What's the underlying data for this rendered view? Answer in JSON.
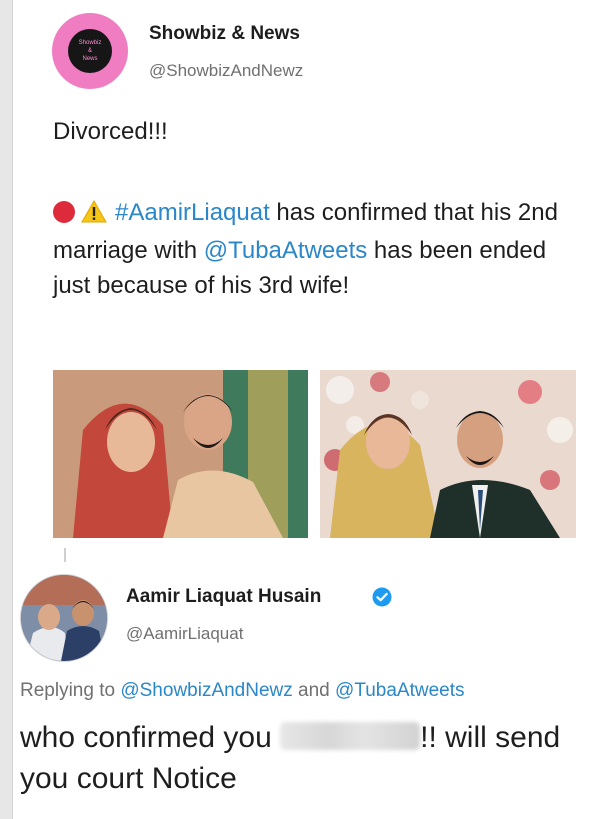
{
  "tweet": {
    "author_name": "Showbiz & News",
    "author_handle": "@ShowbizAndNewz",
    "avatar_text": [
      "Showbiz",
      "&",
      "News"
    ],
    "line1": "Divorced!!!",
    "hashtag": "#AamirLiaquat",
    "text_after_hashtag": " has confirmed that his 2nd marriage with ",
    "mention": "@TubaAtweets",
    "text_end": " has been ended just because of his 3rd wife!"
  },
  "reply": {
    "author_name": "Aamir Liaquat Husain",
    "author_handle": "@AamirLiaquat",
    "replying_prefix": "Replying to ",
    "replying_mention1": "@ShowbizAndNewz",
    "replying_and": " and ",
    "replying_mention2": "@TubaAtweets",
    "text_start": "who confirmed you ",
    "text_end": "!! will send you court Notice"
  },
  "colors": {
    "link": "#2a87c9",
    "avatar_pink": "#f07cc2",
    "verified_blue": "#1d9bf0",
    "red_circle": "#dd2b3c",
    "warning_yellow": "#f5c518"
  }
}
